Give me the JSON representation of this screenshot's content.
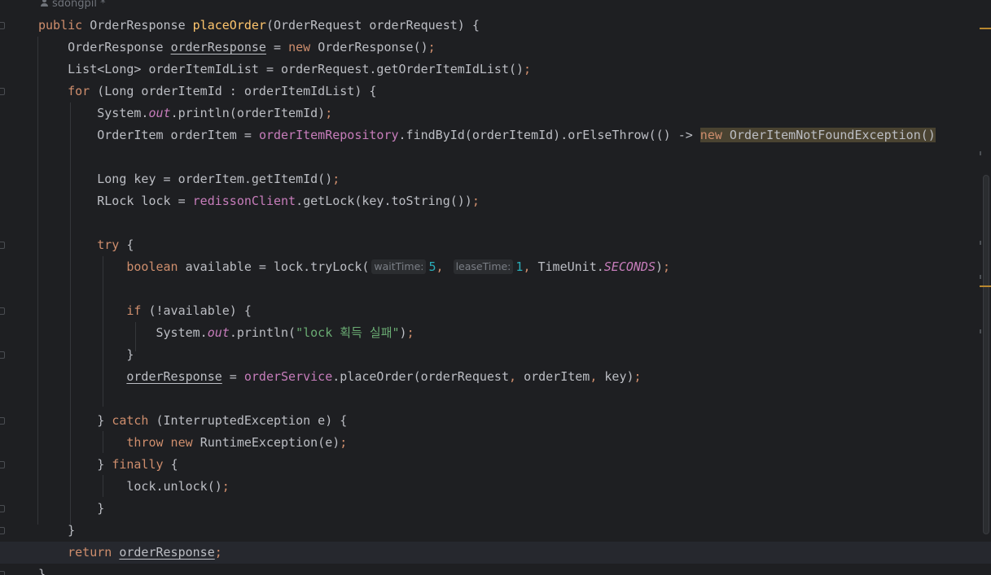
{
  "editor": {
    "author_hint": "sdongpil *",
    "colors": {
      "background": "#1e1f22",
      "keyword": "#cf8e6d",
      "method_decl": "#ffc66d",
      "field": "#c77dbb",
      "string": "#6aab73",
      "number": "#2aacb8",
      "text": "#bcbec4",
      "param_hint": "#7a7e85",
      "current_line": "#26282e",
      "scroll_marker": "#b8872f"
    },
    "lines": [
      [
        [
          "kw",
          "public "
        ],
        [
          "pl",
          "OrderResponse "
        ],
        [
          "fnd",
          "placeOrder"
        ],
        [
          "pl",
          "(OrderRequest orderRequest) {"
        ]
      ],
      [
        [
          "pl",
          "    OrderResponse "
        ],
        [
          "und",
          "orderResponse"
        ],
        [
          "pl",
          " = "
        ],
        [
          "kw",
          "new "
        ],
        [
          "pl",
          "OrderResponse()"
        ],
        [
          "kw",
          ";"
        ]
      ],
      [
        [
          "pl",
          "    List<Long> orderItemIdList = orderRequest.getOrderItemIdList()"
        ],
        [
          "kw",
          ";"
        ]
      ],
      [
        [
          "kw",
          "    for "
        ],
        [
          "pl",
          "(Long orderItemId : orderItemIdList) {"
        ]
      ],
      [
        [
          "pl",
          "        System."
        ],
        [
          "st",
          "out"
        ],
        [
          "pl",
          ".println(orderItemId)"
        ],
        [
          "kw",
          ";"
        ]
      ],
      [
        [
          "pl",
          "        OrderItem orderItem = "
        ],
        [
          "fld",
          "orderItemRepository"
        ],
        [
          "pl",
          ".findById(orderItemId).orElseThrow(() -> "
        ],
        [
          "hlkw",
          "new "
        ],
        [
          "hlpl",
          "OrderItemNotFoundException()"
        ]
      ],
      [
        [
          "pl",
          ""
        ]
      ],
      [
        [
          "pl",
          "        Long key = orderItem.getItemId()"
        ],
        [
          "kw",
          ";"
        ]
      ],
      [
        [
          "pl",
          "        RLock lock = "
        ],
        [
          "fld",
          "redissonClient"
        ],
        [
          "pl",
          ".getLock(key.toString())"
        ],
        [
          "kw",
          ";"
        ]
      ],
      [
        [
          "pl",
          ""
        ]
      ],
      [
        [
          "kw",
          "        try "
        ],
        [
          "pl",
          "{"
        ]
      ],
      [
        [
          "kw",
          "            boolean "
        ],
        [
          "pl",
          "available = lock.tryLock("
        ],
        [
          "hint",
          "waitTime:"
        ],
        [
          "num",
          "5"
        ],
        [
          "kw",
          ", "
        ],
        [
          "hint",
          "leaseTime:"
        ],
        [
          "num",
          "1"
        ],
        [
          "kw",
          ", "
        ],
        [
          "pl",
          "TimeUnit."
        ],
        [
          "st",
          "SECONDS"
        ],
        [
          "pl",
          ")"
        ],
        [
          "kw",
          ";"
        ]
      ],
      [
        [
          "pl",
          ""
        ]
      ],
      [
        [
          "kw",
          "            if "
        ],
        [
          "pl",
          "(!available) {"
        ]
      ],
      [
        [
          "pl",
          "                System."
        ],
        [
          "st",
          "out"
        ],
        [
          "pl",
          ".println("
        ],
        [
          "str",
          "\"lock 획득 실패\""
        ],
        [
          "pl",
          ")"
        ],
        [
          "kw",
          ";"
        ]
      ],
      [
        [
          "pl",
          "            }"
        ]
      ],
      [
        [
          "pl",
          "            "
        ],
        [
          "und",
          "orderResponse"
        ],
        [
          "pl",
          " = "
        ],
        [
          "fld",
          "orderService"
        ],
        [
          "pl",
          ".placeOrder(orderRequest"
        ],
        [
          "kw",
          ", "
        ],
        [
          "pl",
          "orderItem"
        ],
        [
          "kw",
          ", "
        ],
        [
          "pl",
          "key)"
        ],
        [
          "kw",
          ";"
        ]
      ],
      [
        [
          "pl",
          ""
        ]
      ],
      [
        [
          "pl",
          "        } "
        ],
        [
          "kw",
          "catch "
        ],
        [
          "pl",
          "(InterruptedException e) {"
        ]
      ],
      [
        [
          "kw",
          "            throw new "
        ],
        [
          "pl",
          "RuntimeException(e)"
        ],
        [
          "kw",
          ";"
        ]
      ],
      [
        [
          "pl",
          "        } "
        ],
        [
          "kw",
          "finally "
        ],
        [
          "pl",
          "{"
        ]
      ],
      [
        [
          "pl",
          "            lock.unlock()"
        ],
        [
          "kw",
          ";"
        ]
      ],
      [
        [
          "pl",
          "        }"
        ]
      ],
      [
        [
          "pl",
          "    }"
        ]
      ],
      [
        [
          "kw",
          "    return "
        ],
        [
          "und",
          "orderResponse"
        ],
        [
          "kw",
          ";"
        ]
      ],
      [
        [
          "pl",
          "}"
        ]
      ]
    ],
    "current_line_index": 24
  }
}
